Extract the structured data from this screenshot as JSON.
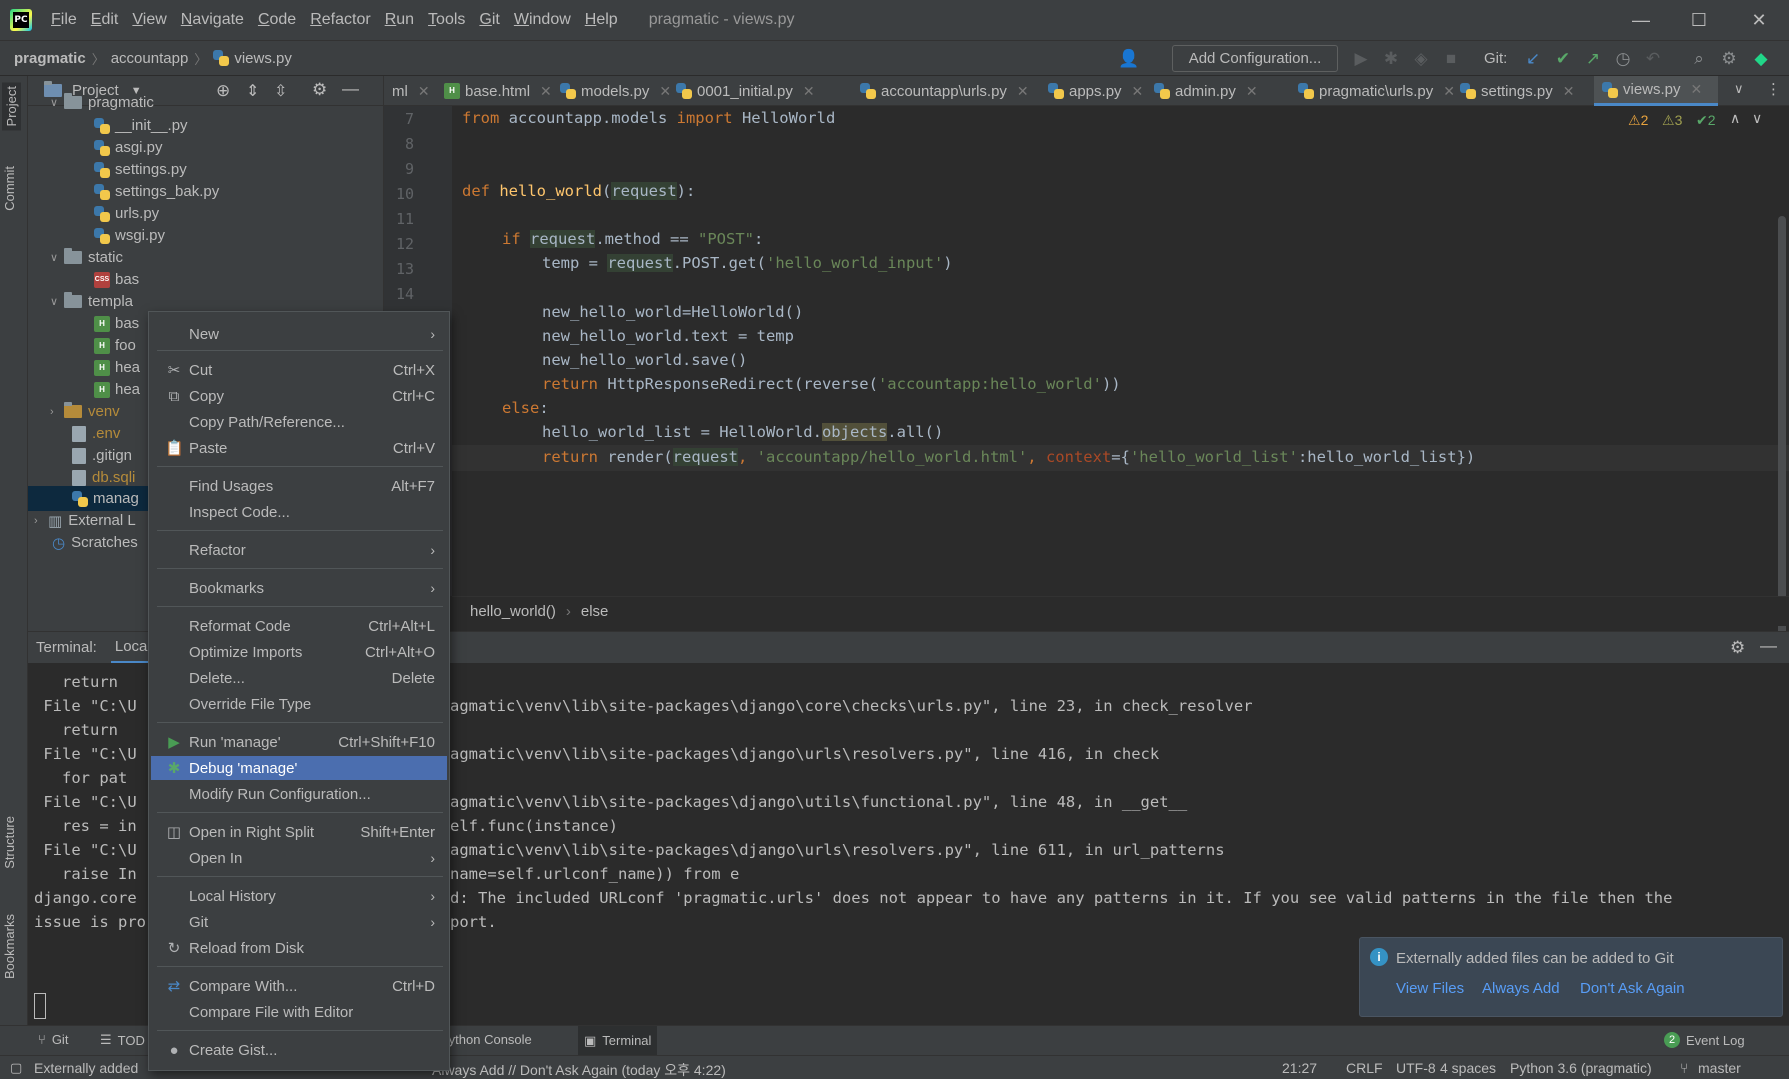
{
  "window": {
    "menu": [
      "File",
      "Edit",
      "View",
      "Navigate",
      "Code",
      "Refactor",
      "Run",
      "Tools",
      "Git",
      "Window",
      "Help"
    ],
    "title": "pragmatic - views.py",
    "minimize": "—",
    "maximize": "☐",
    "close": "✕"
  },
  "navbar": {
    "crumbs": [
      "pragmatic",
      "accountapp",
      "views.py"
    ],
    "add_configuration": "Add Configuration...",
    "git_label": "Git:"
  },
  "project": {
    "title": "Project",
    "tree": [
      {
        "label": "pragmatic",
        "type": "folder",
        "expanded": true
      },
      {
        "label": "__init__.py",
        "type": "py"
      },
      {
        "label": "asgi.py",
        "type": "py"
      },
      {
        "label": "settings.py",
        "type": "py"
      },
      {
        "label": "settings_bak.py",
        "type": "py"
      },
      {
        "label": "urls.py",
        "type": "py"
      },
      {
        "label": "wsgi.py",
        "type": "py"
      },
      {
        "label": "static",
        "type": "folder",
        "expanded": true
      },
      {
        "label": "bas",
        "type": "css"
      },
      {
        "label": "templa",
        "type": "folder",
        "expanded": true
      },
      {
        "label": "bas",
        "type": "html"
      },
      {
        "label": "foo",
        "type": "html"
      },
      {
        "label": "hea",
        "type": "html"
      },
      {
        "label": "hea",
        "type": "html"
      },
      {
        "label": "venv",
        "type": "folder",
        "expanded": false
      },
      {
        "label": ".env",
        "type": "file"
      },
      {
        "label": ".gitign",
        "type": "file"
      },
      {
        "label": "db.sqli",
        "type": "file"
      },
      {
        "label": "manag",
        "type": "py"
      },
      {
        "label": "External L",
        "type": "lib"
      },
      {
        "label": "Scratches",
        "type": "scratch"
      }
    ]
  },
  "left_strip": {
    "project": "Project",
    "commit": "Commit",
    "structure": "Structure",
    "bookmarks": "Bookmarks"
  },
  "tabs": [
    {
      "label": "ml",
      "active": false
    },
    {
      "label": "base.html",
      "active": false
    },
    {
      "label": "models.py",
      "active": false
    },
    {
      "label": "0001_initial.py",
      "active": false
    },
    {
      "label": "accountapp\\urls.py",
      "active": false
    },
    {
      "label": "apps.py",
      "active": false
    },
    {
      "label": "admin.py",
      "active": false
    },
    {
      "label": "pragmatic\\urls.py",
      "active": false
    },
    {
      "label": "settings.py",
      "active": false
    },
    {
      "label": "views.py",
      "active": true
    }
  ],
  "inspections": {
    "warnings": "2",
    "weak": "3",
    "ok": "2"
  },
  "line_numbers": [
    "7",
    "8",
    "9",
    "10",
    "11",
    "12",
    "13",
    "14"
  ],
  "code": {
    "l7_kw1": "from",
    "l7_mod": " accountapp.models ",
    "l7_kw2": "import",
    "l7_rest": " HelloWorld",
    "l10_kw": "def",
    "l10_fn": "hello_world",
    "l10_p": "request",
    "l12_kw": "if",
    "l12_var": "request",
    "l12_mid": ".method == ",
    "l12_str": "\"POST\"",
    "l13_a": "temp = ",
    "l13_var": "request",
    "l13_b": ".POST.get(",
    "l13_str": "'hello_world_input'",
    "l13_c": ")",
    "l15": "new_hello_world=HelloWorld()",
    "l16": "new_hello_world.text = temp",
    "l17": "new_hello_world.save()",
    "l18_kw": "return",
    "l18_a": " HttpResponseRedirect(reverse(",
    "l18_str": "'accountapp:hello_world'",
    "l18_b": "))",
    "l19_kw": "else",
    "l20_a": "hello_world_list = HelloWorld.",
    "l20_hl": "objects",
    "l20_b": ".all()",
    "l21_kw": "return",
    "l21_a": " render(",
    "l21_var": "request",
    "l21_b": ", ",
    "l21_str": "'accountapp/hello_world.html'",
    "l21_c": ", ",
    "l21_prm": "context",
    "l21_d": "={",
    "l21_str2": "'hello_world_list'",
    "l21_e": ":hello_world_list})"
  },
  "editor_breadcrumb": [
    "hello_world()",
    "else"
  ],
  "terminal": {
    "label": "Terminal:",
    "tab": "Loca",
    "left_lines": [
      "   return ",
      " File \"C:\\U",
      "   return ",
      " File \"C:\\U",
      "   for pat",
      " File \"C:\\U",
      "   res = in",
      " File \"C:\\U",
      "   raise In",
      "django.core",
      "issue is pro"
    ],
    "right_lines": [
      "",
      "agmatic\\venv\\lib\\site-packages\\django\\core\\checks\\urls.py\", line 23, in check_resolver",
      "",
      "agmatic\\venv\\lib\\site-packages\\django\\urls\\resolvers.py\", line 416, in check",
      "",
      "agmatic\\venv\\lib\\site-packages\\django\\utils\\functional.py\", line 48, in __get__",
      "elf.func(instance)",
      "agmatic\\venv\\lib\\site-packages\\django\\urls\\resolvers.py\", line 611, in url_patterns",
      "name=self.urlconf_name)) from e",
      "d: The included URLconf 'pragmatic.urls' does not appear to have any patterns in it. If you see valid patterns in the file then the",
      "port."
    ]
  },
  "notification": {
    "message": "Externally added files can be added to Git",
    "view_files": "View Files",
    "always_add": "Always Add",
    "dont_ask": "Don't Ask Again"
  },
  "context_menu": [
    {
      "label": "New",
      "shortcut": "",
      "submenu": true,
      "icon": ""
    },
    {
      "sep": true
    },
    {
      "label": "Cut",
      "shortcut": "Ctrl+X",
      "icon": "✂"
    },
    {
      "label": "Copy",
      "shortcut": "Ctrl+C",
      "icon": "⧉"
    },
    {
      "label": "Copy Path/Reference...",
      "shortcut": "",
      "icon": ""
    },
    {
      "label": "Paste",
      "shortcut": "Ctrl+V",
      "icon": "📋"
    },
    {
      "sep": true
    },
    {
      "label": "Find Usages",
      "shortcut": "Alt+F7",
      "icon": ""
    },
    {
      "label": "Inspect Code...",
      "shortcut": "",
      "icon": ""
    },
    {
      "sep": true
    },
    {
      "label": "Refactor",
      "shortcut": "",
      "submenu": true,
      "icon": ""
    },
    {
      "sep": true
    },
    {
      "label": "Bookmarks",
      "shortcut": "",
      "submenu": true,
      "icon": ""
    },
    {
      "sep": true
    },
    {
      "label": "Reformat Code",
      "shortcut": "Ctrl+Alt+L",
      "icon": ""
    },
    {
      "label": "Optimize Imports",
      "shortcut": "Ctrl+Alt+O",
      "icon": ""
    },
    {
      "label": "Delete...",
      "shortcut": "Delete",
      "icon": ""
    },
    {
      "label": "Override File Type",
      "shortcut": "",
      "icon": ""
    },
    {
      "sep": true
    },
    {
      "label": "Run 'manage'",
      "shortcut": "Ctrl+Shift+F10",
      "icon": "▶"
    },
    {
      "label": "Debug 'manage'",
      "shortcut": "",
      "icon": "🐞",
      "selected": true
    },
    {
      "label": "Modify Run Configuration...",
      "shortcut": "",
      "icon": ""
    },
    {
      "sep": true
    },
    {
      "label": "Open in Right Split",
      "shortcut": "Shift+Enter",
      "icon": "◫"
    },
    {
      "label": "Open In",
      "shortcut": "",
      "submenu": true,
      "icon": ""
    },
    {
      "sep": true
    },
    {
      "label": "Local History",
      "shortcut": "",
      "submenu": true,
      "icon": ""
    },
    {
      "label": "Git",
      "shortcut": "",
      "submenu": true,
      "icon": ""
    },
    {
      "label": "Reload from Disk",
      "shortcut": "",
      "icon": "↻"
    },
    {
      "sep": true
    },
    {
      "label": "Compare With...",
      "shortcut": "Ctrl+D",
      "icon": "⇄"
    },
    {
      "label": "Compare File with Editor",
      "shortcut": "",
      "icon": ""
    },
    {
      "sep": true
    },
    {
      "label": "Create Gist...",
      "shortcut": "",
      "icon": "●"
    }
  ],
  "tool_tabs": {
    "git": "Git",
    "todo": "TOD",
    "python_console": "Python Console",
    "terminal": "Terminal",
    "event_log": "Event Log",
    "event_count": "2"
  },
  "status": {
    "message_left": "Externally added",
    "message_right": "Always Add // Don't Ask Again (today 오후 4:22)",
    "position": "21:27",
    "line_sep": "CRLF",
    "encoding": "UTF-8",
    "indent": "4 spaces",
    "interpreter": "Python 3.6 (pragmatic)",
    "branch": "master"
  },
  "colors": {
    "accent": "#4b6eaf",
    "tab_underline": "#4a88c7",
    "link": "#589df6"
  }
}
